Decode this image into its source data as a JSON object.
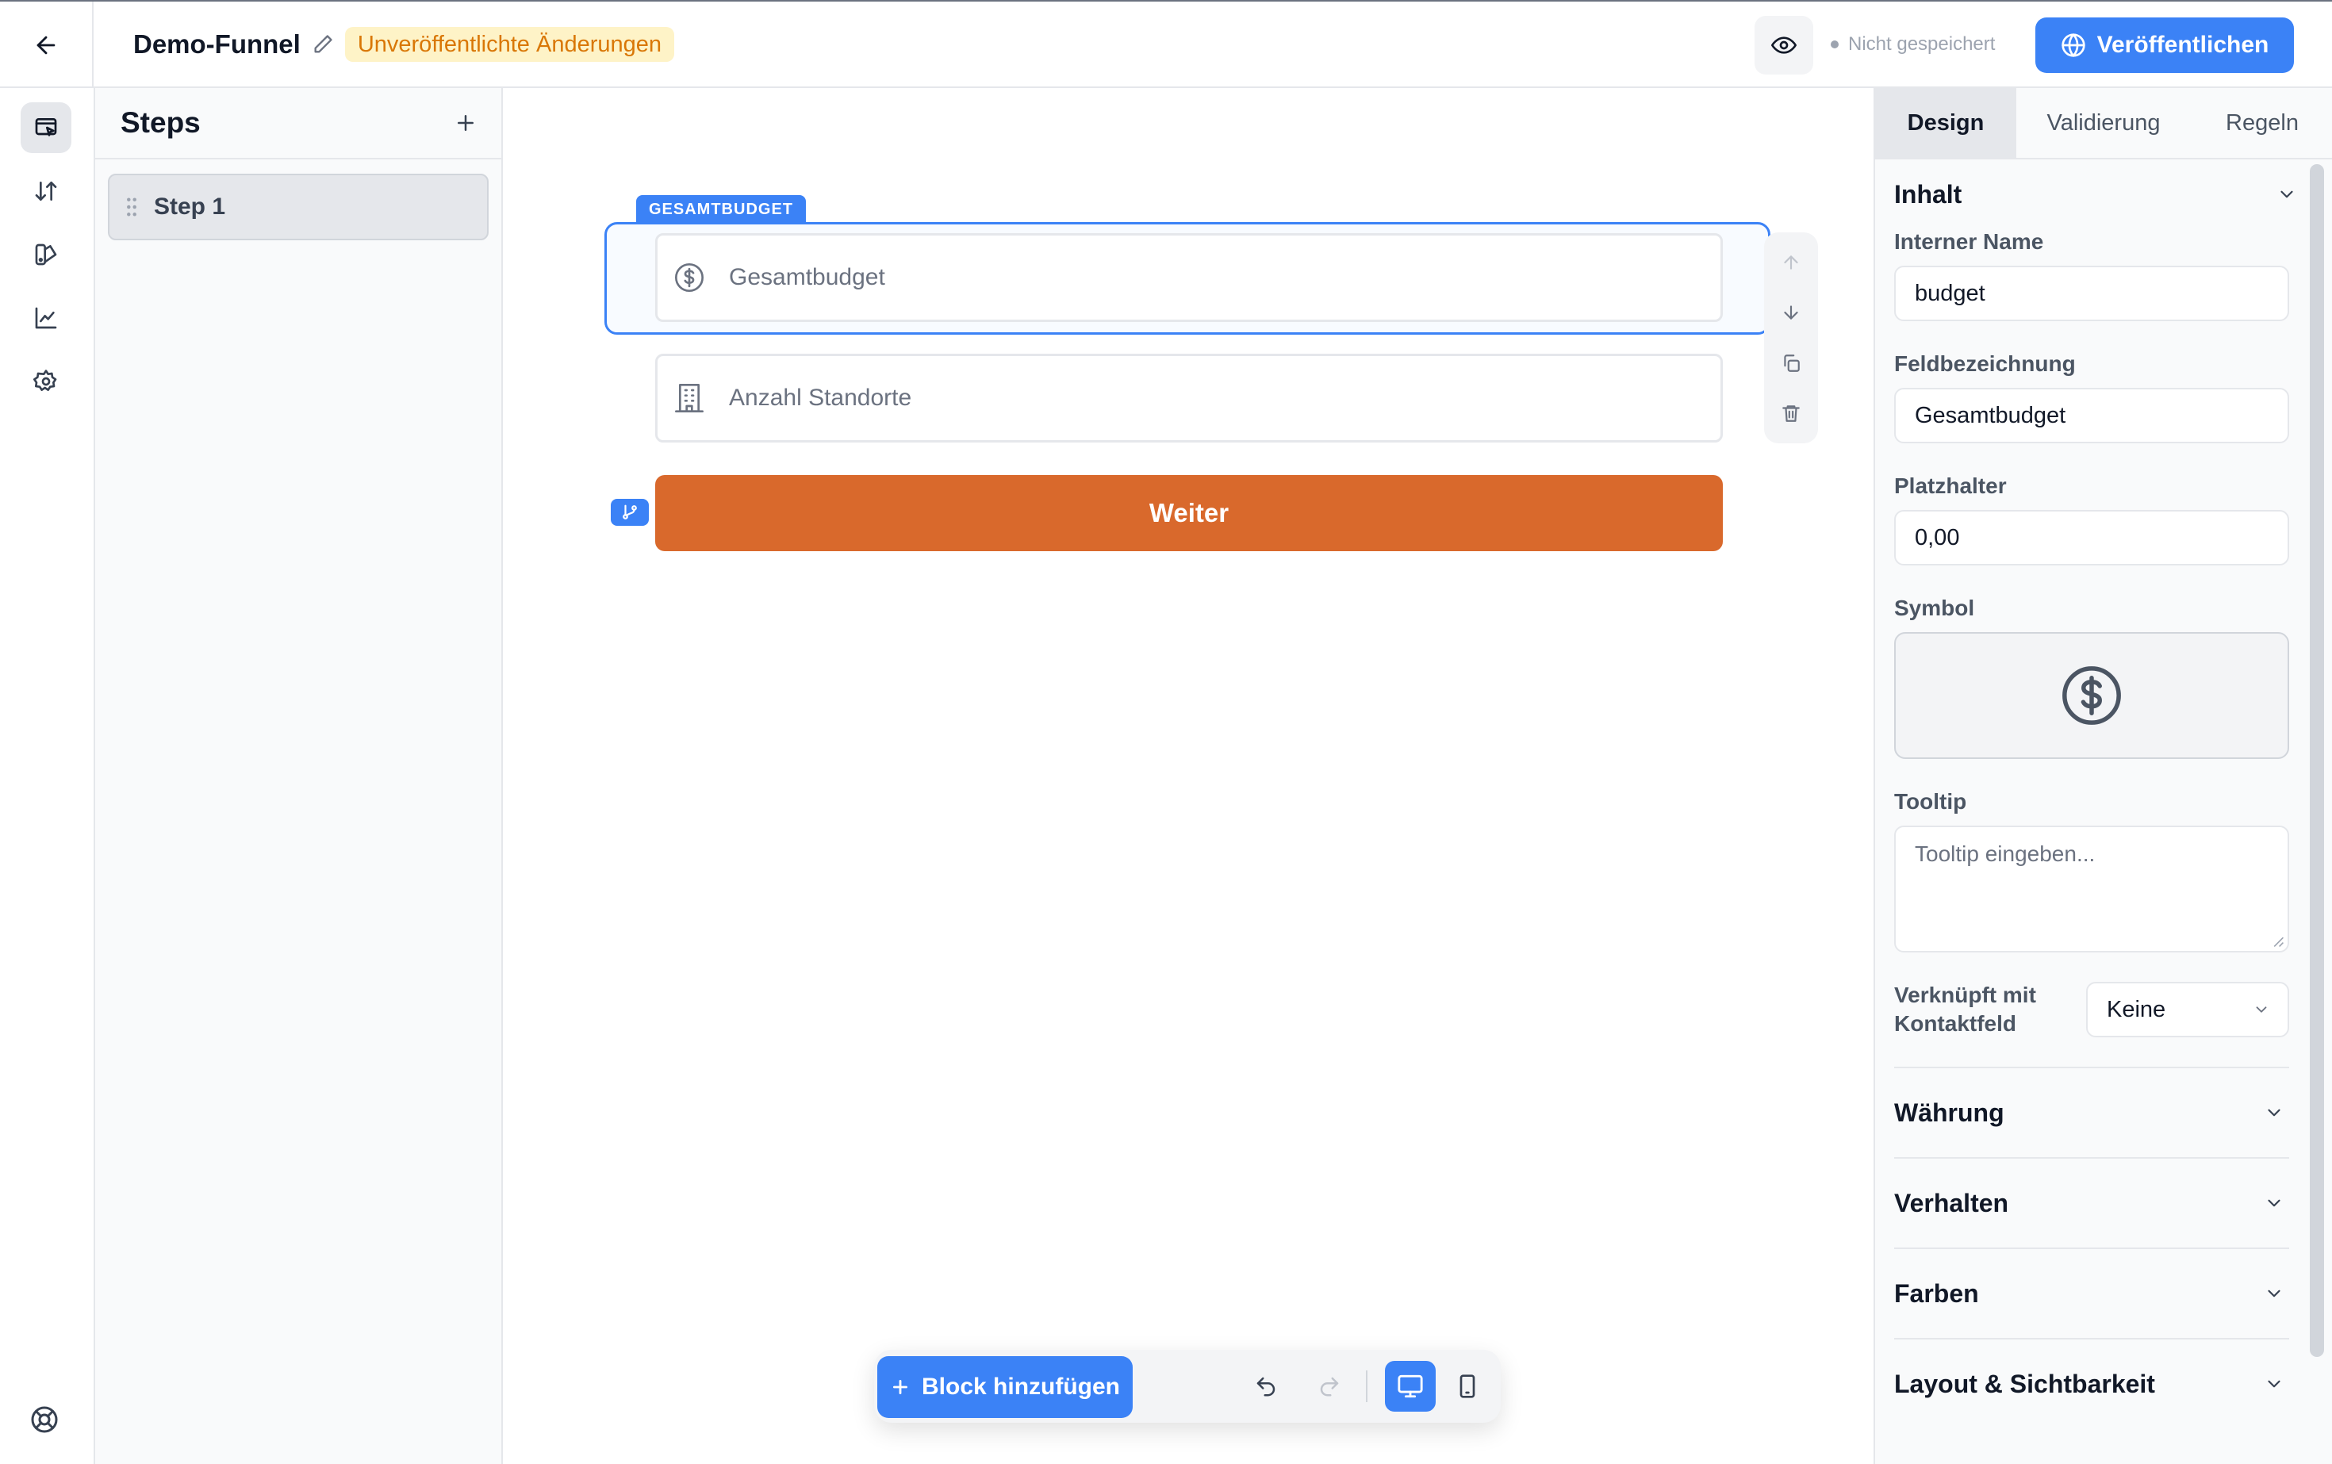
{
  "header": {
    "title": "Demo-Funnel",
    "unpublished_badge": "Unveröffentlichte Änderungen",
    "save_status": "Nicht gespeichert",
    "publish_label": "Veröffentlichen"
  },
  "steps_panel": {
    "title": "Steps",
    "items": [
      {
        "label": "Step 1"
      }
    ]
  },
  "canvas": {
    "selected_tag": "GESAMTBUDGET",
    "fields": [
      {
        "placeholder": "Gesamtbudget",
        "icon": "dollar-circle-icon"
      },
      {
        "placeholder": "Anzahl Standorte",
        "icon": "building-icon"
      }
    ],
    "cta_label": "Weiter"
  },
  "bottom_toolbar": {
    "add_block_label": "Block hinzufügen"
  },
  "right_panel": {
    "tabs": [
      {
        "label": "Design",
        "active": true
      },
      {
        "label": "Validierung",
        "active": false
      },
      {
        "label": "Regeln",
        "active": false
      }
    ],
    "content_section": {
      "title": "Inhalt",
      "internal_name_label": "Interner Name",
      "internal_name_value": "budget",
      "field_label_label": "Feldbezeichnung",
      "field_label_value": "Gesamtbudget",
      "placeholder_label": "Platzhalter",
      "placeholder_value": "0,00",
      "symbol_label": "Symbol",
      "tooltip_label": "Tooltip",
      "tooltip_placeholder": "Tooltip eingeben...",
      "link_label_line1": "Verknüpft mit",
      "link_label_line2": "Kontaktfeld",
      "link_value": "Keine"
    },
    "collapsed_sections": [
      {
        "title": "Währung"
      },
      {
        "title": "Verhalten"
      },
      {
        "title": "Farben"
      },
      {
        "title": "Layout & Sichtbarkeit"
      }
    ]
  },
  "colors": {
    "accent": "#3b82f6",
    "cta": "#d9692c",
    "warning_bg": "#fef3c7",
    "warning_text": "#d97706"
  }
}
